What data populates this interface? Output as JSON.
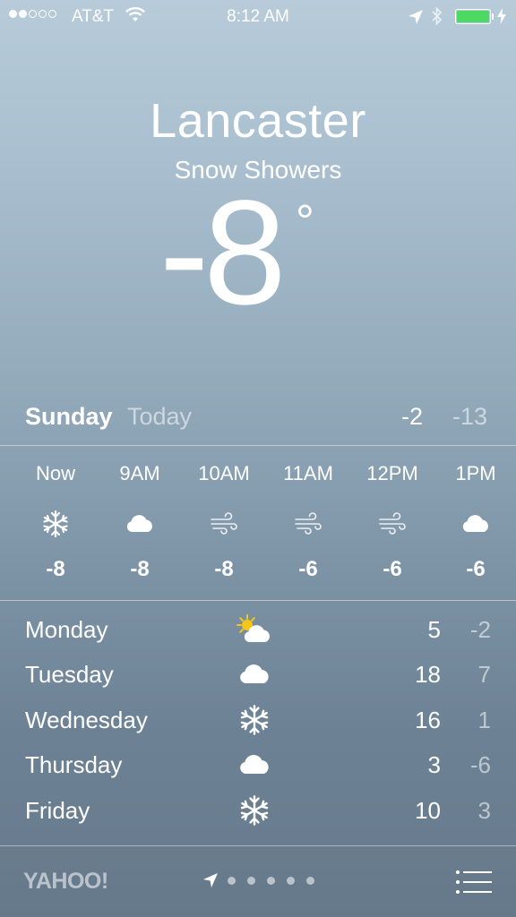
{
  "status_bar": {
    "carrier": "AT&T",
    "time": "8:12 AM",
    "signal_bars": 2,
    "battery_level": 1.0,
    "battery_color": "#4cd964"
  },
  "weather": {
    "city": "Lancaster",
    "condition": "Snow Showers",
    "temperature": "-8",
    "degree_symbol": "°"
  },
  "today": {
    "day": "Sunday",
    "label": "Today",
    "high": "-2",
    "low": "-13"
  },
  "hourly": [
    {
      "time": "Now",
      "icon": "snowflake-icon",
      "temp": "-8"
    },
    {
      "time": "9AM",
      "icon": "cloud-icon",
      "temp": "-8"
    },
    {
      "time": "10AM",
      "icon": "wind-icon",
      "temp": "-8"
    },
    {
      "time": "11AM",
      "icon": "wind-icon",
      "temp": "-6"
    },
    {
      "time": "12PM",
      "icon": "wind-icon",
      "temp": "-6"
    },
    {
      "time": "1PM",
      "icon": "cloud-icon",
      "temp": "-6"
    }
  ],
  "daily": [
    {
      "day": "Monday",
      "icon": "partly-sunny-icon",
      "high": "5",
      "low": "-2"
    },
    {
      "day": "Tuesday",
      "icon": "cloud-icon",
      "high": "18",
      "low": "7"
    },
    {
      "day": "Wednesday",
      "icon": "snowflake-icon",
      "high": "16",
      "low": "1"
    },
    {
      "day": "Thursday",
      "icon": "cloud-icon",
      "high": "3",
      "low": "-6"
    },
    {
      "day": "Friday",
      "icon": "snowflake-icon",
      "high": "10",
      "low": "3"
    }
  ],
  "footer": {
    "provider": "YAHOO!",
    "page_count": 5,
    "current_page_icon": "location-arrow-icon",
    "menu_icon": "list-icon"
  }
}
